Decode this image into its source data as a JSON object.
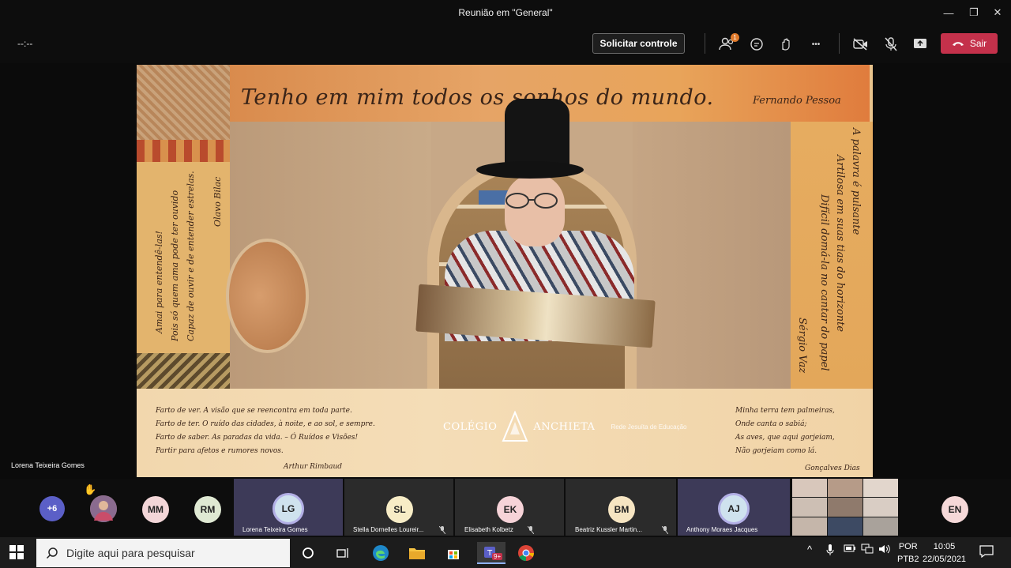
{
  "window": {
    "title": "Reunião em \"General\"",
    "minimize_glyph": "—",
    "maximize_glyph": "❐",
    "close_glyph": "✕"
  },
  "toolbar": {
    "timer": "--:--",
    "request_control_label": "Solicitar controle",
    "participants_badge": "1",
    "more_glyph": "•••",
    "leave_label": "Sair",
    "icons": [
      "participants-icon",
      "chat-icon",
      "raise-hand-icon",
      "more-options-icon",
      "camera-off-icon",
      "mic-off-icon",
      "share-screen-icon",
      "hang-up-icon"
    ]
  },
  "video": {
    "quote_main": "Tenho em mim todos os sonhos do mundo.",
    "quote_author": "Fernando Pessoa",
    "left_vertical_1": "Amai para entendê-las!",
    "left_vertical_2": "Pois só quem ama pode ter ouvido",
    "left_vertical_3": "Capaz de ouvir e de entender estrelas.",
    "left_vertical_author": "Olavo Bilac",
    "right_vertical_1": "A palavra é pulsante",
    "right_vertical_2": "Artilosa em suas tias do horizonte",
    "right_vertical_3": "Difícil domá-la no cantar do papel",
    "right_vertical_author": "Sérgio Vaz",
    "poem_left": [
      "Farto de ver. A visão que se reencontra em toda parte.",
      "Farto de ter. O ruído das cidades, à noite, e ao sol, e sempre.",
      "Farto de saber. As paradas da vida. – Ó Ruídos e Visões!",
      "Partir para afetos e rumores novos."
    ],
    "poem_left_author": "Arthur Rimbaud",
    "poem_right": [
      "Minha terra tem palmeiras,",
      "Onde canta o sabiá;",
      "As aves, que aqui gorjeiam,",
      "Não gorjeiam como lá."
    ],
    "poem_right_author": "Gonçalves Dias",
    "school_name_1": "COLÉGIO",
    "school_name_2": "ANCHIETA",
    "school_sub": "Rede Jesuíta de Educação"
  },
  "speaker_label": "Lorena Teixeira Gomes",
  "participants": {
    "overflow": "+6",
    "avatars": [
      "MM",
      "RM",
      "EN"
    ],
    "tiles": [
      {
        "initials": "LG",
        "name": "Lorena Teixeira Gomes"
      },
      {
        "initials": "SL",
        "name": "Stella Dornelles Loureir..."
      },
      {
        "initials": "EK",
        "name": "Elisabeth Kolbetz"
      },
      {
        "initials": "BM",
        "name": "Beatriz Kussler Martin..."
      },
      {
        "initials": "AJ",
        "name": "Anthony Moraes Jacques"
      }
    ],
    "raise_hand_glyph": "✋"
  },
  "taskbar": {
    "search_placeholder": "Digite aqui para pesquisar",
    "teams_badge": "9+",
    "language_1": "POR",
    "language_2": "PTB2",
    "time": "10:05",
    "date": "22/05/2021",
    "tray_chevron": "^"
  },
  "colors": {
    "leave": "#c4314b",
    "badge": "#e07a2b",
    "active_tile": "#3d3a58"
  }
}
